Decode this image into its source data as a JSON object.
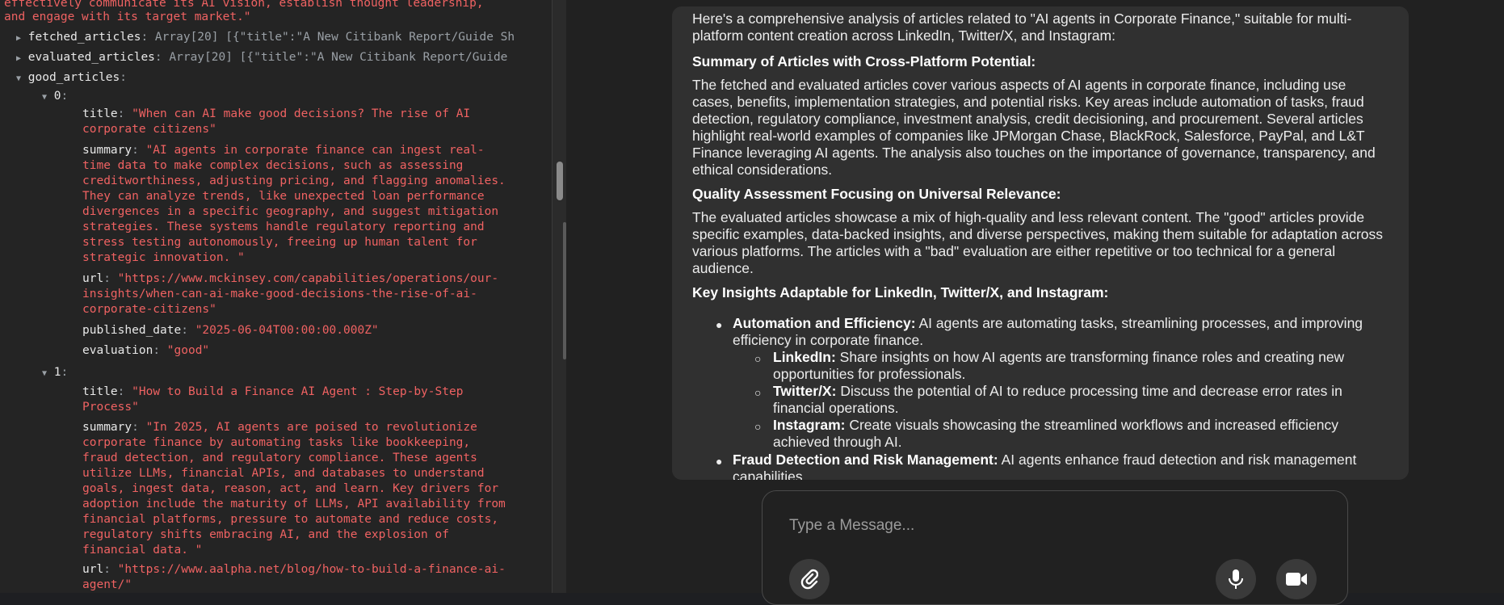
{
  "inspector": {
    "intro_line1": "effectively communicate its AI vision, establish thought leadership,",
    "intro_line2": "and engage with its target market.\"",
    "fetched_key": "fetched_articles",
    "fetched_preview": "Array[20] [{\"title\":\"A New Citibank Report/Guide Sh",
    "evaluated_key": "evaluated_articles",
    "evaluated_preview": "Array[20] [{\"title\":\"A New Citibank Report/Guide",
    "good_key": "good_articles",
    "items": [
      {
        "index": "0",
        "title": [
          "\"When can AI make good decisions? The rise of AI",
          "corporate citizens\""
        ],
        "summary": [
          "\"AI agents in corporate finance can ingest real-",
          "time data to make complex decisions, such as assessing",
          "creditworthiness, adjusting pricing, and flagging anomalies.",
          "They can analyze trends, like unexpected loan performance",
          "divergences in a specific geography, and suggest mitigation",
          "strategies. These systems handle regulatory reporting and",
          "stress testing autonomously, freeing up human talent for",
          "strategic innovation. \""
        ],
        "url": [
          "\"https://www.mckinsey.com/capabilities/operations/our-",
          "insights/when-can-ai-make-good-decisions-the-rise-of-ai-",
          "corporate-citizens\""
        ],
        "published_date": "\"2025-06-04T00:00:00.000Z\"",
        "evaluation": "\"good\""
      },
      {
        "index": "1",
        "title": [
          "\"How to Build a Finance AI Agent : Step-by-Step",
          "Process\""
        ],
        "summary": [
          "\"In 2025, AI agents are poised to revolutionize",
          "corporate finance by automating tasks like bookkeeping,",
          "fraud detection, and regulatory compliance. These agents",
          "utilize LLMs, financial APIs, and databases to understand",
          "goals, ingest data, reason, act, and learn. Key drivers for",
          "adoption include the maturity of LLMs, API availability from",
          "financial platforms, pressure to automate and reduce costs,",
          "regulatory shifts embracing AI, and the explosion of",
          "financial data. \""
        ],
        "url": [
          "\"https://www.aalpha.net/blog/how-to-build-a-finance-ai-",
          "agent/\""
        ]
      }
    ],
    "labels": {
      "title": "title",
      "summary": "summary",
      "url": "url",
      "published_date": "published_date",
      "evaluation": "evaluation"
    }
  },
  "chat": {
    "intro": [
      "Here's a comprehensive analysis of articles related to \"AI agents in Corporate Finance,\" suitable for multi-",
      "platform content creation across LinkedIn, Twitter/X, and Instagram:"
    ],
    "h1": "Summary of Articles with Cross-Platform Potential:",
    "p1": [
      "The fetched and evaluated articles cover various aspects of AI agents in corporate finance, including use",
      "cases, benefits, implementation strategies, and potential risks. Key areas include automation of tasks, fraud",
      "detection, regulatory compliance, investment analysis, credit decisioning, and procurement. Several articles",
      "highlight real-world examples of companies like JPMorgan Chase, BlackRock, Salesforce, PayPal, and L&T",
      "Finance leveraging AI agents. The analysis also touches on the importance of governance, transparency, and",
      "ethical considerations."
    ],
    "h2": "Quality Assessment Focusing on Universal Relevance:",
    "p2": [
      "The evaluated articles showcase a mix of high-quality and less relevant content. The \"good\" articles provide",
      "specific examples, data-backed insights, and diverse perspectives, making them suitable for adaptation across",
      "various platforms. The articles with a \"bad\" evaluation are either repetitive or too technical for a general",
      "audience."
    ],
    "h3": "Key Insights Adaptable for LinkedIn, Twitter/X, and Instagram:",
    "b1_bold": "Automation and Efficiency:",
    "b1_text": [
      "AI agents are automating tasks, streamlining processes, and improving",
      "efficiency in corporate finance."
    ],
    "sub1_bold": "LinkedIn:",
    "sub1_text": [
      "Share insights on how AI agents are transforming finance roles and creating new",
      "opportunities for professionals."
    ],
    "sub2_bold": "Twitter/X:",
    "sub2_text": [
      "Discuss the potential of AI to reduce processing time and decrease error rates in",
      "financial operations."
    ],
    "sub3_bold": "Instagram:",
    "sub3_text": [
      "Create visuals showcasing the streamlined workflows and increased efficiency",
      "achieved through AI."
    ],
    "b2_bold": "Fraud Detection and Risk Management:",
    "b2_text": [
      "AI agents enhance fraud detection and risk management",
      "capabilities"
    ]
  },
  "composer": {
    "placeholder": "Type a Message...",
    "attach_icon": "paperclip-icon",
    "mic_icon": "microphone-icon",
    "video_icon": "video-camera-icon"
  }
}
